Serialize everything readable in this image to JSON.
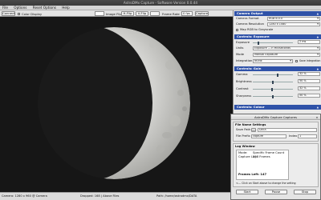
{
  "window": {
    "title": "AstroDMx Capture - Software Version 0.0.44"
  },
  "menu": [
    "File",
    "Options",
    "Reset Options",
    "Help"
  ],
  "toolbar": {
    "connect": "Connect",
    "color_display": "Color Display",
    "image_flip": "Image Flip",
    "h_flip": "H-Flip",
    "v_flip": "V-Flip",
    "frame_rate_label": "Frame Rate",
    "frame_rate": "0 fps",
    "capture": "Capture"
  },
  "status": {
    "camera": "Camera: 1280 x 960 @ Camera",
    "frames": "Dropped: 168 | Above Files",
    "path": "Path: /home/astrodmx/DATA"
  },
  "camera_output": {
    "title": "Camera Output",
    "format_label": "Camera Format",
    "format": "RGB 8.0.0",
    "resolution_label": "Camera Resolution",
    "resolution": "1280 x 1080",
    "mono_label": "Map RGB to Grayscale"
  },
  "controls_exposure": {
    "title": "Controls: Exposure",
    "exposure_label": "Exposure",
    "exposure_value": "2 ms",
    "units_label": "Units",
    "units": "Exposure ---> Milliseconds",
    "mode_label": "Mode",
    "mode": "Manual Exposure",
    "integration_label": "Integration",
    "integration": "NONE",
    "integration_check": "Save Integration"
  },
  "controls_gain": {
    "title": "Controls: Gain",
    "rows": [
      {
        "label": "Gamma",
        "value": "32 %",
        "level": 0.62
      },
      {
        "label": "Brightness",
        "value": "50 %",
        "level": 0.5
      },
      {
        "label": "Contrast",
        "value": "32 %",
        "level": 0.48
      },
      {
        "label": "Sharpness",
        "value": "50 %",
        "level": 0.5
      }
    ]
  },
  "controls_colour": {
    "title": "Controls: Colour"
  },
  "dialog": {
    "title": "AstroDMx Capture Captures",
    "close": "×",
    "file_group": "File Name Settings",
    "save_path_label": "Save Path",
    "save_path": "DATA",
    "file_prefix_label": "File Prefix",
    "file_prefix": "capture",
    "index_label": "Index",
    "index": "1",
    "log_group": "Log Window",
    "log": [
      {
        "key": "Mode:",
        "val": "Specific Frame Count"
      },
      {
        "key": "Capture Log:",
        "val": "258 Frames"
      }
    ],
    "frames_left": "Frames Left: 147",
    "hint": "<--- Click on Start above to change the setting",
    "buttons": [
      "Start",
      "Pause",
      "Stop"
    ]
  },
  "colors": {
    "section_header": "#2f52a8",
    "moon_light": "#d8d8d6",
    "sky": "#161616"
  }
}
